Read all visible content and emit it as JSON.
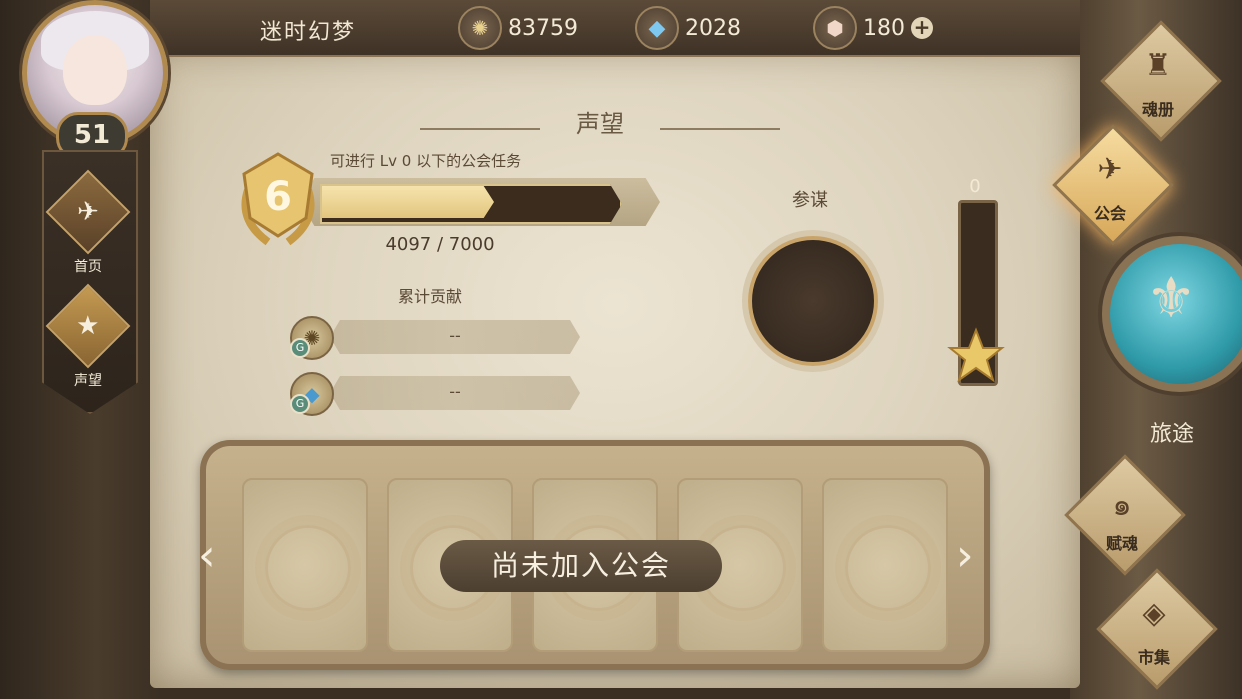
{
  "header": {
    "player_name": "迷时幻梦",
    "currencies": [
      {
        "icon": "gold-coin-icon",
        "value": "83759"
      },
      {
        "icon": "blue-crystal-icon",
        "value": "2028"
      },
      {
        "icon": "gem-icon",
        "value": "180"
      }
    ],
    "add_symbol": "+"
  },
  "player": {
    "level": "51"
  },
  "left_nav": [
    {
      "label": "首页",
      "icon": "home-emblem-icon"
    },
    {
      "label": "声望",
      "icon": "laurel-star-icon",
      "active": true
    }
  ],
  "reputation": {
    "title": "声望",
    "hint": "可进行 Lv 0 以下的公会任务",
    "rank": "6",
    "progress_current": 4097,
    "progress_max": 7000,
    "progress_text": "4097  /  7000",
    "contribution_title": "累计贡献",
    "contributions": [
      {
        "icon": "gold-coin-icon",
        "value": "--"
      },
      {
        "icon": "blue-crystal-icon",
        "value": "--"
      }
    ],
    "contrib_badge": "G"
  },
  "advisor": {
    "label": "参谋"
  },
  "gauge": {
    "value": "0"
  },
  "guild": {
    "status": "尚未加入公会",
    "card_count": 5,
    "left_arrow": "‹",
    "right_arrow": "›"
  },
  "right_nav": [
    {
      "label": "魂册",
      "icon": "helmet-icon"
    },
    {
      "label": "公会",
      "icon": "guild-emblem-icon",
      "active": true
    },
    {
      "label": "旅途",
      "icon": "compass-emblem-icon"
    },
    {
      "label": "赋魂",
      "icon": "flame-swirl-icon"
    },
    {
      "label": "市集",
      "icon": "crystal-icon"
    }
  ],
  "colors": {
    "accent_gold": "#e2c67e",
    "panel": "#dcd2bc",
    "dark_wood": "#3a2e22"
  }
}
